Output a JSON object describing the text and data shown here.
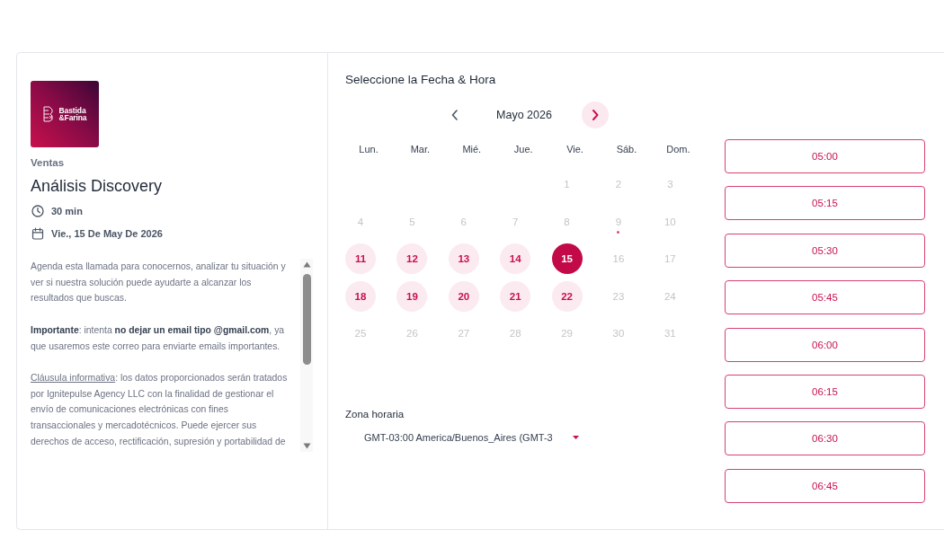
{
  "sidebar": {
    "logo": {
      "lines": [
        "Bastida",
        "&Farina"
      ]
    },
    "category": "Ventas",
    "title": "Análisis Discovery",
    "details": [
      {
        "kind": "duration",
        "text": "30 min"
      },
      {
        "kind": "date",
        "text": "Vie., 15 De May De 2026"
      }
    ],
    "description": [
      {
        "kind": "text",
        "text": "Agenda esta llamada para conocernos, analizar tu situación y ver si nuestra solución puede ayudarte a alcanzar los resultados que buscas."
      },
      {
        "kind": "text",
        "text": "**Importante**: intenta **no dejar un email tipo @gmail.com**, ya que usaremos este correo para enviarte emails importantes."
      },
      {
        "kind": "clause",
        "link": "Cláusula informativa",
        "text": ": los datos proporcionados serán tratados por Ignitepulse Agency LLC con la finalidad de gestionar el envío de comunicaciones electrónicas con fines transaccionales y mercadotécnicos. Puede ejercer sus derechos de acceso, rectificación, supresión y portabilidad de"
      }
    ]
  },
  "scheduler": {
    "title": "Seleccione la Fecha & Hora",
    "month": "Mayo 2026",
    "prev_month": {
      "disabled": true
    },
    "next_month": {
      "disabled": false
    },
    "weekdays": [
      "Lun.",
      "Mar.",
      "Mié.",
      "Jue.",
      "Vie.",
      "Sáb.",
      "Dom."
    ],
    "weeks": [
      [
        {
          "day": "1",
          "available": false,
          "selected": false,
          "today": false
        },
        {
          "day": "2",
          "available": false,
          "selected": false,
          "today": false
        },
        {
          "day": "3",
          "available": false,
          "selected": false,
          "today": false
        }
      ],
      [
        {
          "day": "4",
          "available": false,
          "selected": false,
          "today": false
        },
        {
          "day": "5",
          "available": false,
          "selected": false,
          "today": false
        },
        {
          "day": "6",
          "available": false,
          "selected": false,
          "today": false
        },
        {
          "day": "7",
          "available": false,
          "selected": false,
          "today": false
        },
        {
          "day": "8",
          "available": false,
          "selected": false,
          "today": false
        },
        {
          "day": "9",
          "available": false,
          "selected": false,
          "today": true
        },
        {
          "day": "10",
          "available": false,
          "selected": false,
          "today": false
        }
      ],
      [
        {
          "day": "11",
          "available": true,
          "selected": false,
          "today": false
        },
        {
          "day": "12",
          "available": true,
          "selected": false,
          "today": false
        },
        {
          "day": "13",
          "available": true,
          "selected": false,
          "today": false
        },
        {
          "day": "14",
          "available": true,
          "selected": false,
          "today": false
        },
        {
          "day": "15",
          "available": true,
          "selected": true,
          "today": false
        },
        {
          "day": "16",
          "available": false,
          "selected": false,
          "today": false
        },
        {
          "day": "17",
          "available": false,
          "selected": false,
          "today": false
        }
      ],
      [
        {
          "day": "18",
          "available": true,
          "selected": false,
          "today": false
        },
        {
          "day": "19",
          "available": true,
          "selected": false,
          "today": false
        },
        {
          "day": "20",
          "available": true,
          "selected": false,
          "today": false
        },
        {
          "day": "21",
          "available": true,
          "selected": false,
          "today": false
        },
        {
          "day": "22",
          "available": true,
          "selected": false,
          "today": false
        },
        {
          "day": "23",
          "available": false,
          "selected": false,
          "today": false
        },
        {
          "day": "24",
          "available": false,
          "selected": false,
          "today": false
        }
      ],
      [
        {
          "day": "25",
          "available": false,
          "selected": false,
          "today": false
        },
        {
          "day": "26",
          "available": false,
          "selected": false,
          "today": false
        },
        {
          "day": "27",
          "available": false,
          "selected": false,
          "today": false
        },
        {
          "day": "28",
          "available": false,
          "selected": false,
          "today": false
        },
        {
          "day": "29",
          "available": false,
          "selected": false,
          "today": false
        },
        {
          "day": "30",
          "available": false,
          "selected": false,
          "today": false
        },
        {
          "day": "31",
          "available": false,
          "selected": false,
          "today": false
        }
      ]
    ],
    "timezone": {
      "label": "Zona horaria",
      "value": "GMT-03:00 America/Buenos_Aires (GMT-3"
    },
    "time_slots": [
      {
        "time": "05:00",
        "selected": false
      },
      {
        "time": "05:15",
        "selected": false
      },
      {
        "time": "05:30",
        "selected": false
      },
      {
        "time": "05:45",
        "selected": false
      },
      {
        "time": "06:00",
        "selected": false
      },
      {
        "time": "06:15",
        "selected": false
      },
      {
        "time": "06:30",
        "selected": false
      },
      {
        "time": "06:45",
        "selected": false
      }
    ]
  }
}
